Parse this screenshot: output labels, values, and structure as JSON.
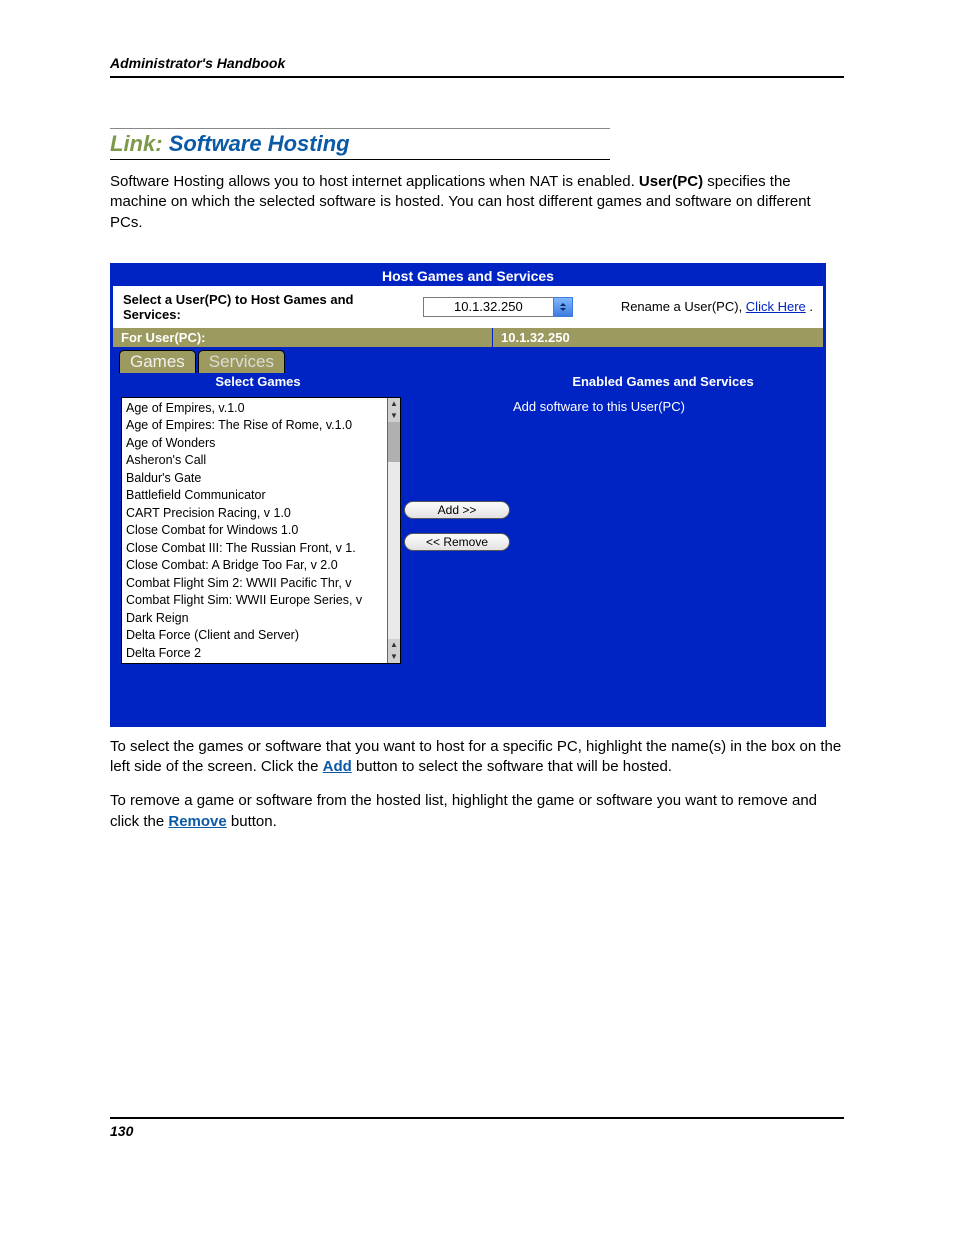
{
  "header": {
    "title": "Administrator's Handbook"
  },
  "heading": {
    "prefix": "Link:",
    "title": "Software Hosting"
  },
  "intro": {
    "part1": "Software Hosting allows you to host internet applications when NAT is enabled. ",
    "bold": "User(PC)",
    "part2": " specifies the machine on which the selected software is hosted. You can host different games and software on different PCs."
  },
  "panel": {
    "title": "Host Games and Services",
    "select_label": "Select a User(PC) to Host Games and Services:",
    "ip": "10.1.32.250",
    "rename_text": "Rename a User(PC), ",
    "rename_link": "Click Here",
    "rename_dot": " .",
    "for_user_label": "For User(PC):",
    "for_user_value": "10.1.32.250",
    "tabs": {
      "games": "Games",
      "services": "Services"
    },
    "col_left": "Select Games",
    "col_right": "Enabled Games and Services",
    "games_list": [
      "Age of Empires, v.1.0",
      "Age of Empires: The Rise of Rome, v.1.0",
      "Age of Wonders",
      "Asheron's Call",
      "Baldur's Gate",
      "Battlefield Communicator",
      "CART Precision Racing, v 1.0",
      "Close Combat for Windows 1.0",
      "Close Combat III: The Russian Front, v 1.",
      "Close Combat: A Bridge Too Far, v 2.0",
      "Combat Flight Sim 2: WWII Pacific Thr, v",
      "Combat Flight Sim: WWII Europe Series, v",
      "Dark Reign",
      "Delta Force (Client and Server)",
      "Delta Force 2"
    ],
    "add_btn": "Add >>",
    "remove_btn": "<< Remove",
    "enabled_msg": "Add software to this User(PC)"
  },
  "below": {
    "p1a": "To select the games or software that you want to host for a specific PC, highlight the name(s) in the box on the left side of the screen. Click the ",
    "p1_btn": "Add",
    "p1b": " button to select the software that will be hosted.",
    "p2a": "To remove a game or software from the hosted list, highlight the game or software you want to remove and click the ",
    "p2_btn": "Remove",
    "p2b": " button."
  },
  "footer": {
    "page": "130"
  }
}
